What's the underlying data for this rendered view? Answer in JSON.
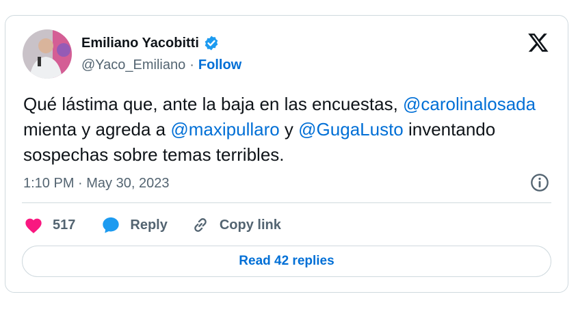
{
  "author": {
    "name": "Emiliano Yacobitti",
    "handle": "@Yaco_Emiliano",
    "separator": "·",
    "follow_label": "Follow"
  },
  "tweet": {
    "segments": [
      {
        "type": "text",
        "value": "Qué lástima que, ante la baja en las encuestas, "
      },
      {
        "type": "mention",
        "value": "@carolinalosada"
      },
      {
        "type": "text",
        "value": " mienta y agreda a "
      },
      {
        "type": "mention",
        "value": "@maxipullaro"
      },
      {
        "type": "text",
        "value": " y "
      },
      {
        "type": "mention",
        "value": "@GugaLusto"
      },
      {
        "type": "text",
        "value": " inventando sospechas sobre temas terribles."
      }
    ],
    "timestamp": "1:10 PM · May 30, 2023"
  },
  "actions": {
    "likes_count": "517",
    "reply_label": "Reply",
    "copy_link_label": "Copy link"
  },
  "footer": {
    "read_replies_label": "Read 42 replies"
  },
  "colors": {
    "link": "#006fd6",
    "like": "#f91880",
    "verified": "#1d9bf0",
    "muted": "#536471"
  },
  "icons": [
    "verified-badge-icon",
    "x-logo-icon",
    "info-icon",
    "heart-icon",
    "reply-icon",
    "link-icon"
  ]
}
